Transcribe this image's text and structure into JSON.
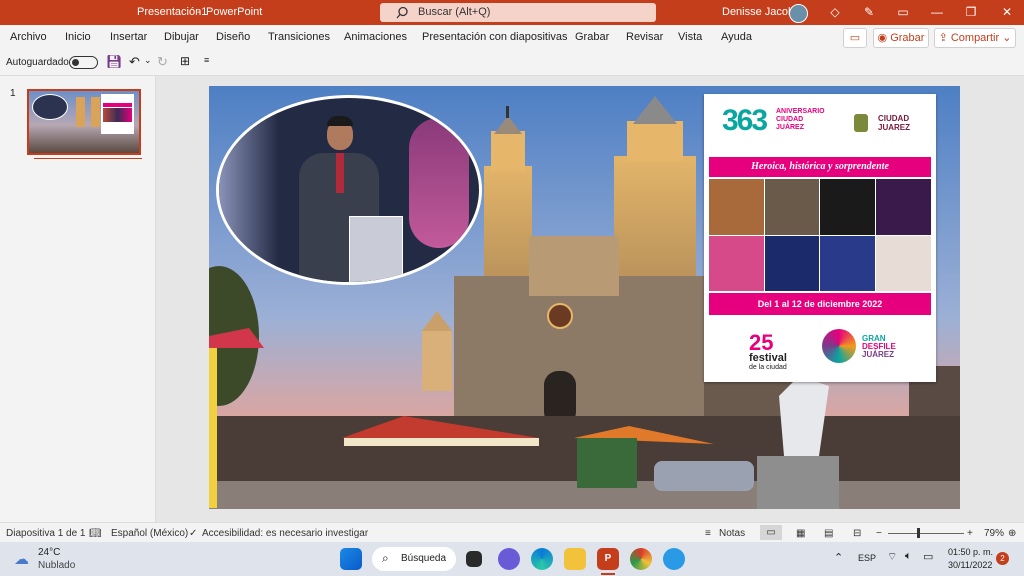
{
  "titlebar": {
    "file_name": "Presentación1",
    "separator": "-",
    "app_name": "PowerPoint",
    "search_placeholder": "Buscar (Alt+Q)",
    "user_name": "Denisse Jacobo"
  },
  "ribbon": {
    "tabs": [
      "Archivo",
      "Inicio",
      "Insertar",
      "Dibujar",
      "Diseño",
      "Transiciones",
      "Animaciones",
      "Presentación con diapositivas",
      "Grabar",
      "Revisar",
      "Vista",
      "Ayuda"
    ],
    "record_label": "Grabar",
    "share_label": "Compartir"
  },
  "qat": {
    "autosave_label": "Autoguardado"
  },
  "thumbnails": {
    "slide_number": "1"
  },
  "slide": {
    "poster": {
      "anniversary_number": "363",
      "anniversary_line1": "ANIVERSARIO",
      "anniversary_line2": "CIUDAD",
      "anniversary_line3": "JUÁREZ",
      "city_logo_line1": "CIUDAD",
      "city_logo_line2": "JUAREZ",
      "tagline": "Heroica, histórica y sorprendente",
      "dates": "Del 1 al 12 de diciembre 2022",
      "festival_number": "25",
      "festival_line1": "festival",
      "festival_line2": "de la ciudad",
      "parade_line1": "GRAN",
      "parade_line2": "DESFILE",
      "parade_line3": "JUÁREZ"
    }
  },
  "statusbar": {
    "slide_info": "Diapositiva 1 de 1",
    "language": "Español (México)",
    "accessibility": "Accesibilidad: es necesario investigar",
    "notes_label": "Notas",
    "zoom": "79%"
  },
  "taskbar": {
    "weather_temp": "24°C",
    "weather_desc": "Nublado",
    "search_label": "Búsqueda",
    "language": "ESP",
    "time": "01:50 p. m.",
    "date": "30/11/2022",
    "notification_count": "2"
  },
  "colors": {
    "accent": "#c43e1c",
    "taskbar": "#dfe4ec",
    "poster_pink": "#e6007e"
  }
}
